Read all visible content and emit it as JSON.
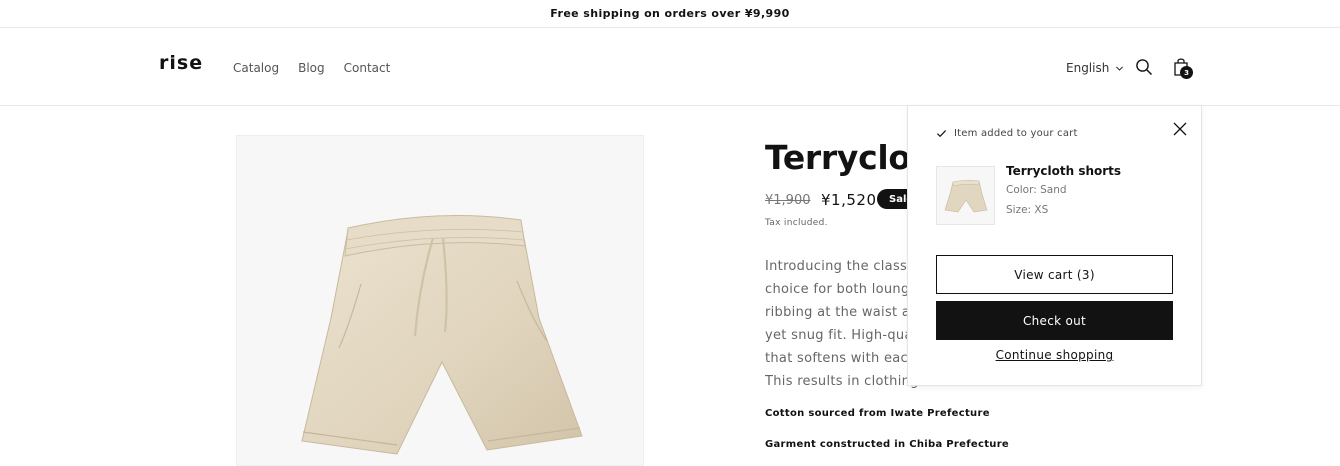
{
  "announcement": {
    "text": "Free shipping on orders over ¥9,990"
  },
  "header": {
    "logo": "rise",
    "nav": [
      {
        "label": "Catalog"
      },
      {
        "label": "Blog"
      },
      {
        "label": "Contact"
      }
    ],
    "language": "English",
    "cart_count": "3"
  },
  "product": {
    "title": "Terrycloth shorts",
    "price_old": "¥1,900",
    "price_new": "¥1,520",
    "sale_badge": "Sale",
    "tax_note": "Tax included.",
    "description_lines": [
      "Introducing the classic o",
      "choice for both loungin",
      "ribbing at the waist and",
      "yet snug fit. High-qualit",
      "that softens with each w",
      "This results in clothing t"
    ],
    "facts": [
      "Cotton sourced from Iwate Prefecture",
      "Garment constructed in Chiba Prefecture"
    ]
  },
  "cart_drawer": {
    "added_message": "Item added to your cart",
    "item": {
      "name": "Terrycloth shorts",
      "color": "Color: Sand",
      "size": "Size: XS"
    },
    "view_cart_label": "View cart (3)",
    "checkout_label": "Check out",
    "continue_label": "Continue shopping"
  },
  "icons": {
    "search": "search-icon",
    "cart": "bag-icon",
    "close": "close-icon",
    "check": "check-icon",
    "chevron": "chevron-down-icon"
  },
  "colors": {
    "text": "#121212",
    "muted": "#777777",
    "shorts": "#e3d8c2",
    "button_dark": "#121212"
  }
}
